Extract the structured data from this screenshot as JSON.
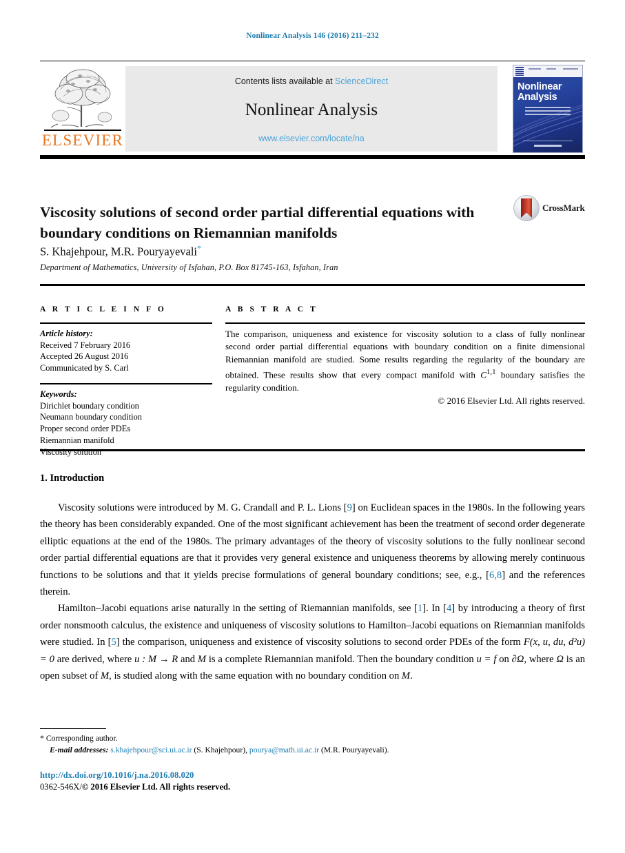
{
  "running_head": "Nonlinear Analysis 146 (2016) 211–232",
  "masthead": {
    "publisher_name": "ELSEVIER",
    "contents_prefix": "Contents lists available at ",
    "contents_link": "ScienceDirect",
    "journal_name": "Nonlinear Analysis",
    "journal_url": "www.elsevier.com/locate/na",
    "cover": {
      "title_line1": "Nonlinear",
      "title_line2": "Analysis"
    }
  },
  "article": {
    "title": "Viscosity solutions of second order partial differential equations with boundary conditions on Riemannian manifolds",
    "crossmark_label": "CrossMark",
    "authors": "S. Khajehpour, M.R. Pouryayevali",
    "author_marker": "*",
    "affiliation": "Department of Mathematics, University of Isfahan, P.O. Box 81745-163, Isfahan, Iran"
  },
  "info": {
    "heading": "A R T I C L E   I N F O",
    "history_label": "Article history:",
    "history": [
      "Received 7 February 2016",
      "Accepted 26 August 2016",
      "Communicated by S. Carl"
    ],
    "keywords_label": "Keywords:",
    "keywords": [
      "Dirichlet boundary condition",
      "Neumann boundary condition",
      "Proper second order PDEs",
      "Riemannian manifold",
      "Viscosity solution"
    ]
  },
  "abstract": {
    "heading": "A B S T R A C T",
    "text_part1": "The comparison, uniqueness and existence for viscosity solution to a class of fully nonlinear second order partial differential equations with boundary condition on a finite dimensional Riemannian manifold are studied. Some results regarding the regularity of the boundary are obtained. These results show that every compact manifold with ",
    "math_C": "C",
    "math_C_sup": "1,1",
    "text_part2": " boundary satisfies the regularity condition.",
    "copyright": "© 2016 Elsevier Ltd. All rights reserved."
  },
  "body": {
    "section_title": "1. Introduction",
    "p1_a": "Viscosity solutions were introduced by M. G. Crandall and P. L. Lions [",
    "p1_ref1": "9",
    "p1_b": "] on Euclidean spaces in the 1980s. In the following years the theory has been considerably expanded. One of the most significant achievement has been the treatment of second order degenerate elliptic equations at the end of the 1980s. The primary advantages of the theory of viscosity solutions to the fully nonlinear second order partial differential equations are that it provides very general existence and uniqueness theorems by allowing merely continuous functions to be solutions and that it yields precise formulations of general boundary conditions; see, e.g., [",
    "p1_ref2": "6,8",
    "p1_c": "] and the references therein.",
    "p2_a": "Hamilton–Jacobi equations arise naturally in the setting of Riemannian manifolds, see [",
    "p2_ref1": "1",
    "p2_b": "]. In [",
    "p2_ref2": "4",
    "p2_c": "] by introducing a theory of first order nonsmooth calculus, the existence and uniqueness of viscosity solutions to Hamilton–Jacobi equations on Riemannian manifolds were studied. In [",
    "p2_ref3": "5",
    "p2_d": "] the comparison, uniqueness and existence of viscosity solutions to second order PDEs of the form ",
    "p2_eq1": "F(x, u, du, d²u) = 0",
    "p2_e": " are derived, where ",
    "p2_eq2": "u : M → R",
    "p2_f": " and ",
    "p2_eq3": "M",
    "p2_g": " is a complete Riemannian manifold. Then the boundary condition ",
    "p2_eq4": "u = f",
    "p2_h": " on ",
    "p2_eq5": "∂Ω",
    "p2_i": ", where ",
    "p2_eq6": "Ω",
    "p2_j": " is an open subset of ",
    "p2_eq7": "M",
    "p2_k": ", is studied along with the same equation with no boundary condition on ",
    "p2_eq8": "M",
    "p2_l": "."
  },
  "footnotes": {
    "corresponding": "Corresponding author.",
    "corresponding_marker": "*",
    "email_label": "E-mail addresses:",
    "email1": "s.khajehpour@sci.ui.ac.ir",
    "email1_owner": "(S. Khajehpour),",
    "email2": "pourya@math.ui.ac.ir",
    "email2_owner": "(M.R. Pouryayevali)."
  },
  "footer": {
    "doi": "http://dx.doi.org/10.1016/j.na.2016.08.020",
    "issn_line_plain": "0362-546X/",
    "issn_line_copy": "© 2016 Elsevier Ltd.",
    "issn_line_rights": " All rights reserved."
  },
  "colors": {
    "link_blue": "#1a7bb0",
    "sciencedirect_blue": "#4aa3d8",
    "elsevier_orange": "#e87722",
    "cover_blue": "#2b3f91"
  }
}
